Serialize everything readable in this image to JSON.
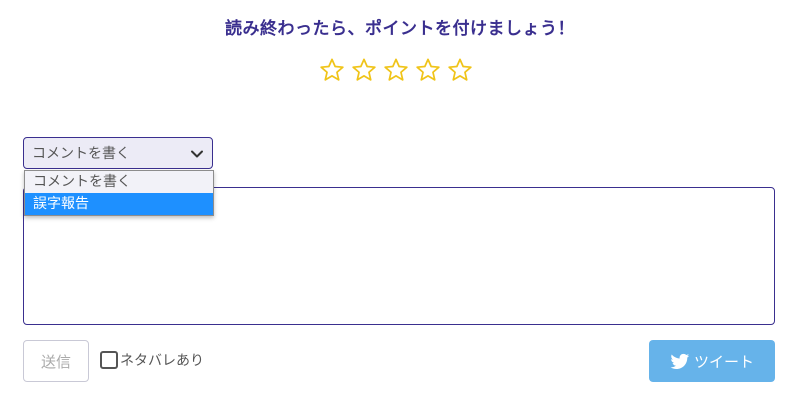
{
  "rating": {
    "prompt": "読み終わったら、ポイントを付けましょう！",
    "stars_total": 5,
    "stars_filled": 0,
    "star_color": "#f0c419"
  },
  "comment": {
    "select_value": "コメントを書く",
    "options": [
      "コメントを書く",
      "誤字報告"
    ],
    "highlighted_option": "誤字報告",
    "textarea_value": ""
  },
  "actions": {
    "send_label": "送信",
    "spoiler_label": "ネタバレあり",
    "spoiler_checked": false,
    "tweet_label": "ツイート"
  },
  "colors": {
    "heading": "#3a2f8f",
    "border": "#3a2f8f",
    "highlight": "#1e90ff",
    "tweet": "#66b3ea"
  }
}
